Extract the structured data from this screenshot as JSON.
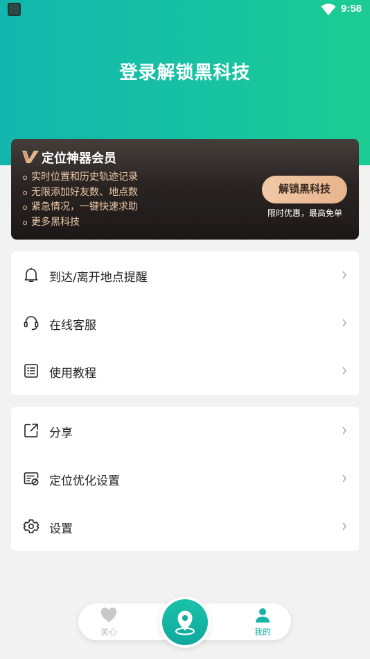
{
  "status_bar": {
    "time": "9:58"
  },
  "header": {
    "title": "登录解锁黑科技"
  },
  "vip": {
    "title": "定位神器会员",
    "features": [
      "实时位置和历史轨迹记录",
      "无限添加好友数、地点数",
      "紧急情况，一键快速求助",
      "更多黑科技"
    ],
    "button_label": "解锁黑科技",
    "promo": "限时优惠，最高免单"
  },
  "menu_group_1": [
    {
      "label": "到达/离开地点提醒",
      "icon": "bell-icon"
    },
    {
      "label": "在线客服",
      "icon": "headset-icon"
    },
    {
      "label": "使用教程",
      "icon": "list-document-icon"
    }
  ],
  "menu_group_2": [
    {
      "label": "分享",
      "icon": "share-icon"
    },
    {
      "label": "定位优化设置",
      "icon": "location-settings-icon"
    },
    {
      "label": "设置",
      "icon": "gear-icon"
    }
  ],
  "tabs": {
    "care": {
      "label": "关心",
      "icon": "heart-icon"
    },
    "mine": {
      "label": "我的",
      "icon": "user-icon",
      "active": true
    }
  },
  "colors": {
    "accent": "#17b4a6",
    "gold": "#f0c9a7",
    "header_gradient_start": "#12b6ae",
    "header_gradient_end": "#1ccc92"
  }
}
